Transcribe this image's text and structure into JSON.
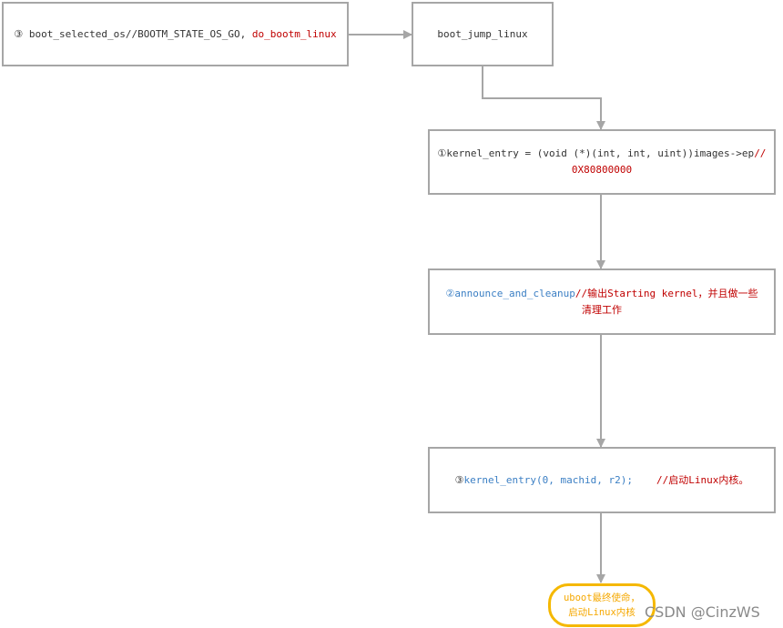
{
  "nodes": {
    "n1": {
      "prefix": "③ ",
      "text_a": "boot_selected_os//BOOTM_STATE_OS_GO, ",
      "text_b": "do_bootm_linux"
    },
    "n2": {
      "text": "boot_jump_linux"
    },
    "n3": {
      "prefix": "①",
      "text_a": "kernel_entry = (void (*)(int, int, uint))images->ep",
      "text_b": "//",
      "text_c": "0X80800000"
    },
    "n4": {
      "prefix": "②",
      "text_a": "announce_and_cleanup",
      "text_b": "//输出Starting kernel，并且做一些",
      "text_c": "清理工作"
    },
    "n5": {
      "prefix": "③",
      "text_a": "kernel_entry(0, machid, r2);",
      "text_b": "//启动Linux内核。"
    },
    "n6": {
      "line1": "uboot最终使命，",
      "line2": "启动Linux内核"
    }
  },
  "watermark": "CSDN @CinzWS",
  "colors": {
    "border": "#a6a6a6",
    "arrow": "#a6a6a6",
    "red_text": "#c00000",
    "blue_text": "#3b7fc4",
    "highlight": "#f5b800"
  }
}
